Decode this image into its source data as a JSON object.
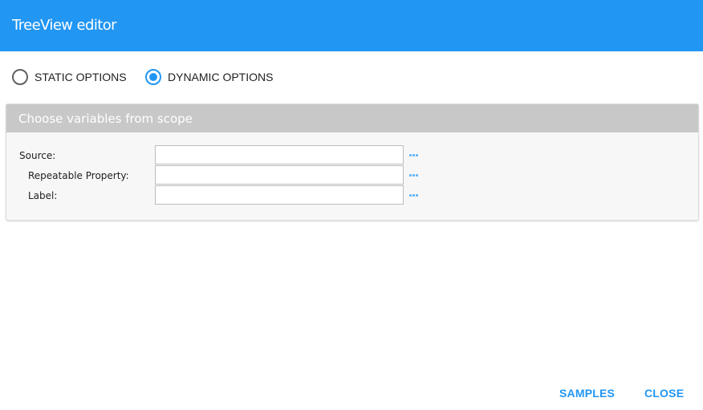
{
  "dialog": {
    "title": "TreeView editor"
  },
  "options": {
    "static_label": "STATIC OPTIONS",
    "dynamic_label": "DYNAMIC OPTIONS",
    "selected": "dynamic"
  },
  "panel": {
    "title": "Choose variables from scope",
    "fields": [
      {
        "label": "Source:",
        "value": ""
      },
      {
        "label": "Repeatable Property:",
        "value": ""
      },
      {
        "label": "Label:",
        "value": ""
      }
    ]
  },
  "footer": {
    "samples_label": "SAMPLES",
    "close_label": "CLOSE"
  },
  "colors": {
    "accent": "#2196f3",
    "header_bg": "#c8c8c8",
    "panel_bg": "#f7f7f7"
  }
}
